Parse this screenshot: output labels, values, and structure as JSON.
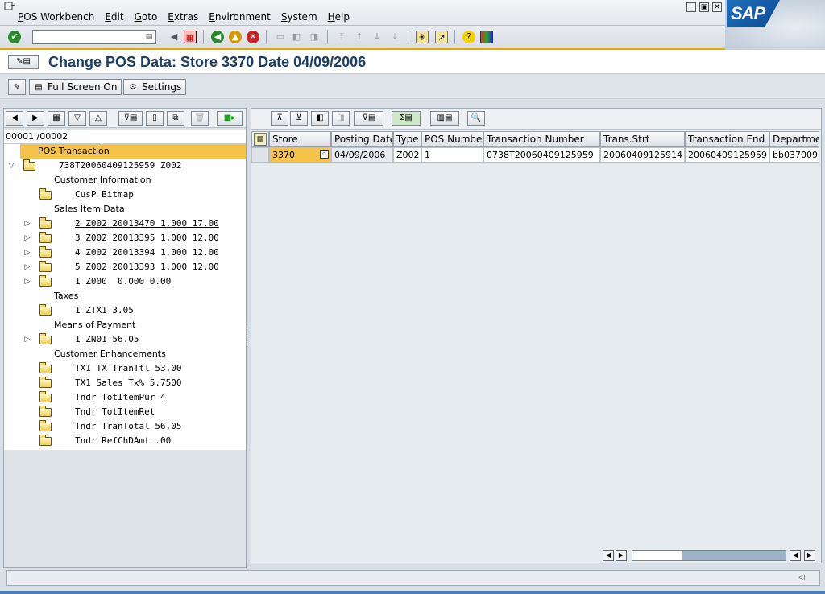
{
  "menu": {
    "items": [
      {
        "underline": "P",
        "rest": "OS Workbench"
      },
      {
        "underline": "E",
        "rest": "dit"
      },
      {
        "underline": "G",
        "rest": "oto"
      },
      {
        "underline": "E",
        "rest": "xtras"
      },
      {
        "underline": "E",
        "rest": "nvironment"
      },
      {
        "underline": "S",
        "rest": "ystem"
      },
      {
        "underline": "H",
        "rest": "elp"
      }
    ]
  },
  "logo": "SAP",
  "command_field": {
    "value": ""
  },
  "title": "Change POS Data: Store 3370 Date 04/09/2006",
  "app_toolbar": {
    "full_screen": "Full Screen On",
    "settings": "Settings"
  },
  "tree": {
    "counter": "00001 /00002",
    "nodes": [
      {
        "label": "POS Transaction",
        "level": 0,
        "selected": true,
        "folder": false,
        "expander": "",
        "mono": false
      },
      {
        "label": "738T20060409125959 Z002",
        "level": 0,
        "selected": false,
        "folder": true,
        "expander": "down",
        "mono": true
      },
      {
        "label": "Customer Information",
        "level": 1,
        "selected": false,
        "folder": false,
        "expander": "",
        "mono": false
      },
      {
        "label": "CusP Bitmap",
        "level": 2,
        "selected": false,
        "folder": true,
        "expander": "",
        "mono": true
      },
      {
        "label": "Sales Item Data",
        "level": 1,
        "selected": false,
        "folder": false,
        "expander": "",
        "mono": false
      },
      {
        "label": "2 Z002 20013470 1.000 17.00",
        "level": 2,
        "selected": false,
        "folder": true,
        "expander": "right",
        "mono": true,
        "underlined": true
      },
      {
        "label": "3 Z002 20013395 1.000 12.00",
        "level": 2,
        "selected": false,
        "folder": true,
        "expander": "right",
        "mono": true
      },
      {
        "label": "4 Z002 20013394 1.000 12.00",
        "level": 2,
        "selected": false,
        "folder": true,
        "expander": "right",
        "mono": true
      },
      {
        "label": "5 Z002 20013393 1.000 12.00",
        "level": 2,
        "selected": false,
        "folder": true,
        "expander": "right",
        "mono": true
      },
      {
        "label": "1 Z000  0.000 0.00",
        "level": 2,
        "selected": false,
        "folder": true,
        "expander": "right",
        "mono": true
      },
      {
        "label": "Taxes",
        "level": 1,
        "selected": false,
        "folder": false,
        "expander": "",
        "mono": false
      },
      {
        "label": "1 ZTX1 3.05",
        "level": 2,
        "selected": false,
        "folder": true,
        "expander": "",
        "mono": true
      },
      {
        "label": "Means of Payment",
        "level": 1,
        "selected": false,
        "folder": false,
        "expander": "",
        "mono": false
      },
      {
        "label": "1 ZN01 56.05",
        "level": 2,
        "selected": false,
        "folder": true,
        "expander": "right",
        "mono": true
      },
      {
        "label": "Customer Enhancements",
        "level": 1,
        "selected": false,
        "folder": false,
        "expander": "",
        "mono": false
      },
      {
        "label": "TX1 TX TranTtl 53.00",
        "level": 2,
        "selected": false,
        "folder": true,
        "expander": "",
        "mono": true
      },
      {
        "label": "TX1 Sales Tx% 5.7500",
        "level": 2,
        "selected": false,
        "folder": true,
        "expander": "",
        "mono": true
      },
      {
        "label": "Tndr TotItemPur 4",
        "level": 2,
        "selected": false,
        "folder": true,
        "expander": "",
        "mono": true
      },
      {
        "label": "Tndr TotItemRet",
        "level": 2,
        "selected": false,
        "folder": true,
        "expander": "",
        "mono": true
      },
      {
        "label": "Tndr TranTotal 56.05",
        "level": 2,
        "selected": false,
        "folder": true,
        "expander": "",
        "mono": true
      },
      {
        "label": "Tndr RefChDAmt .00",
        "level": 2,
        "selected": false,
        "folder": true,
        "expander": "",
        "mono": true
      }
    ]
  },
  "grid": {
    "columns": [
      "Store",
      "Posting Date",
      "Type",
      "POS Number",
      "Transaction Number",
      "Trans.Strt",
      "Transaction End",
      "Departmen"
    ],
    "rows": [
      [
        "3370",
        "04/09/2006",
        "Z002",
        "1",
        "0738T20060409125959",
        "20060409125914",
        "20060409125959",
        "bb037009"
      ]
    ]
  },
  "status": {
    "text": ""
  }
}
